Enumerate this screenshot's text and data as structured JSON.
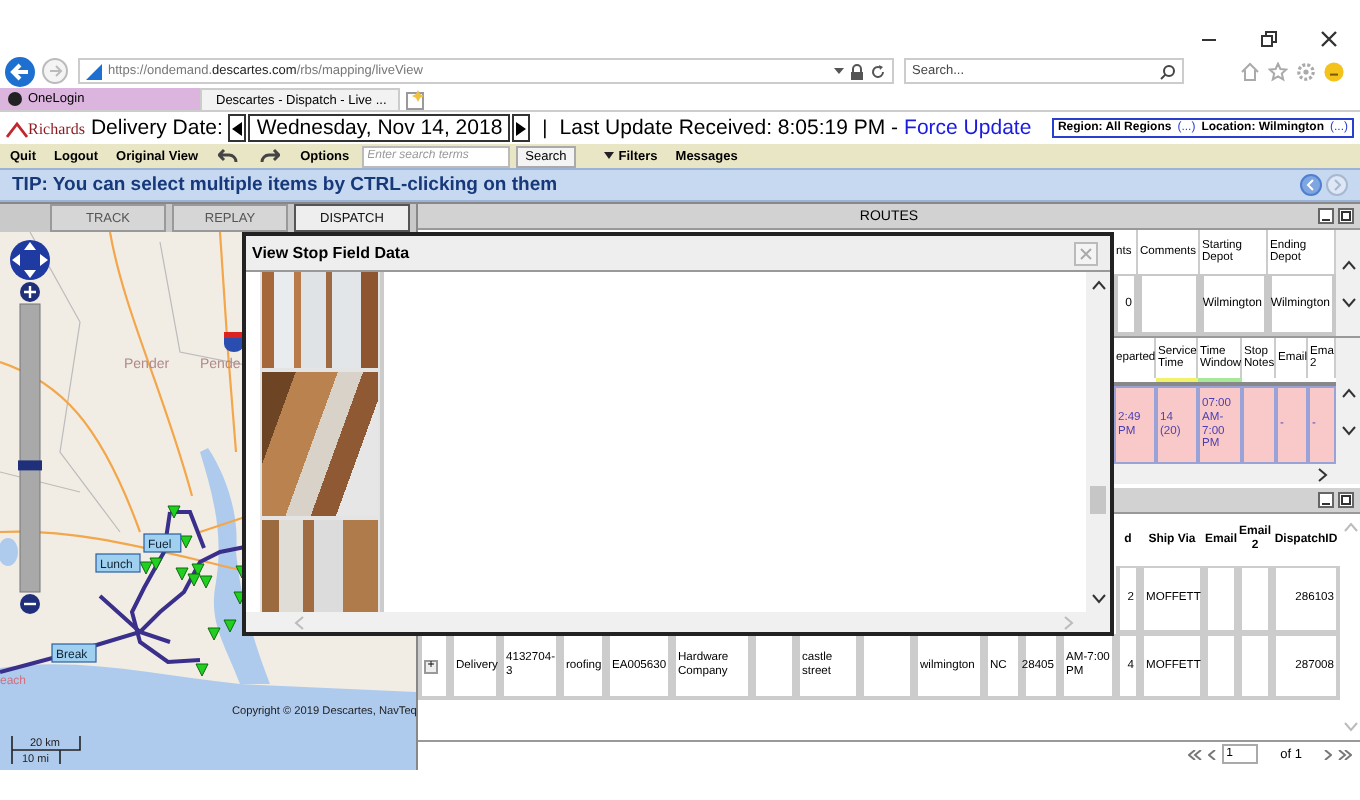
{
  "browser": {
    "url": "https://ondemand.**descartes.com**/rbs/mapping/liveView",
    "search_placeholder": "Search...",
    "tabs": [
      {
        "label": "OneLogin",
        "selected": false
      },
      {
        "label": "Descartes - Dispatch - Live ...",
        "selected": true
      }
    ]
  },
  "header": {
    "logo": "Richards",
    "date_label": "Delivery Date:",
    "date": "Wednesday, Nov 14, 2018",
    "separator": "|",
    "last_update": "Last Update Received: 8:05:19 PM -",
    "force_update": "Force Update",
    "region_label": "Region: All Regions",
    "region_link": "(...)",
    "location_label": "Location: Wilmington",
    "location_link": "(...)"
  },
  "toolbar": [
    {
      "kind": "button",
      "label": "Quit"
    },
    {
      "kind": "button",
      "label": "Logout"
    },
    {
      "kind": "button",
      "label": "Original View"
    },
    {
      "kind": "undo"
    },
    {
      "kind": "redo"
    },
    {
      "kind": "button",
      "label": "Options"
    },
    {
      "kind": "search",
      "placeholder": "Enter search terms"
    },
    {
      "kind": "boxed",
      "label": "Search"
    },
    {
      "kind": "dropdown",
      "label": "Filters"
    },
    {
      "kind": "button",
      "label": "Messages"
    }
  ],
  "tip": "TIP: You can select multiple items by CTRL-clicking on them",
  "map_tabs": [
    {
      "label": "TRACK",
      "selected": false
    },
    {
      "label": "REPLAY",
      "selected": false
    },
    {
      "label": "DISPATCH",
      "selected": true
    }
  ],
  "map": {
    "labels": [
      {
        "kind": "place",
        "text": "Pender"
      },
      {
        "kind": "place",
        "text": "Pende"
      },
      {
        "kind": "tag",
        "text": "Lunch"
      },
      {
        "kind": "tag",
        "text": "Fuel"
      },
      {
        "kind": "tag",
        "text": "Break"
      },
      {
        "kind": "coast",
        "text": "each"
      }
    ],
    "zoom": {
      "level": 0.42
    },
    "copyright": "Copyright © 2019 Descartes, NavTeq",
    "scale_km": "20 km",
    "scale_mi": "10 mi"
  },
  "routes_panel": {
    "title": "ROUTES",
    "routes_table": {
      "columns": [
        "nts",
        "Comments",
        "Starting Depot",
        "Ending Depot"
      ],
      "rows": [
        {
          "cells": [
            "0",
            null,
            "Wilmington",
            "Wilmington"
          ]
        }
      ]
    },
    "stops_table": {
      "columns": [
        {
          "label": "eparted"
        },
        {
          "label": "Service Time",
          "color": "#f2f26a"
        },
        {
          "label": "Time Window",
          "color": "#a8e89a"
        },
        {
          "label": "Stop Notes"
        },
        {
          "label": "Email"
        },
        {
          "label": "Ema 2"
        }
      ],
      "rows": [
        {
          "color": "#f9c9c9",
          "cells": [
            "2:49 PM",
            "14 (20)",
            "07:00 AM-7:00 PM",
            null,
            "-",
            "-"
          ]
        }
      ]
    }
  },
  "orders_table": {
    "columns": [
      "d",
      "Ship Via",
      "Email",
      "Email 2",
      "DispatchID"
    ],
    "rows": [
      {
        "cells": [
          "2",
          "MOFFETT",
          null,
          null,
          "286103"
        ]
      },
      {
        "cells": [
          "+",
          "Delivery",
          "4132704-3",
          "roofing",
          "EA005630",
          "Hardware Company",
          null,
          "castle street",
          null,
          "wilmington",
          "NC",
          "28405",
          "AM-7:00 PM",
          "4",
          "MOFFETT",
          null,
          null,
          "287008"
        ]
      }
    ],
    "pager": {
      "page": "1",
      "of": "of 1"
    }
  },
  "dialog": {
    "title": "View Stop Field Data",
    "photos": [
      {
        "kind": "photo"
      },
      {
        "kind": "photo"
      },
      {
        "kind": "photo"
      }
    ]
  }
}
